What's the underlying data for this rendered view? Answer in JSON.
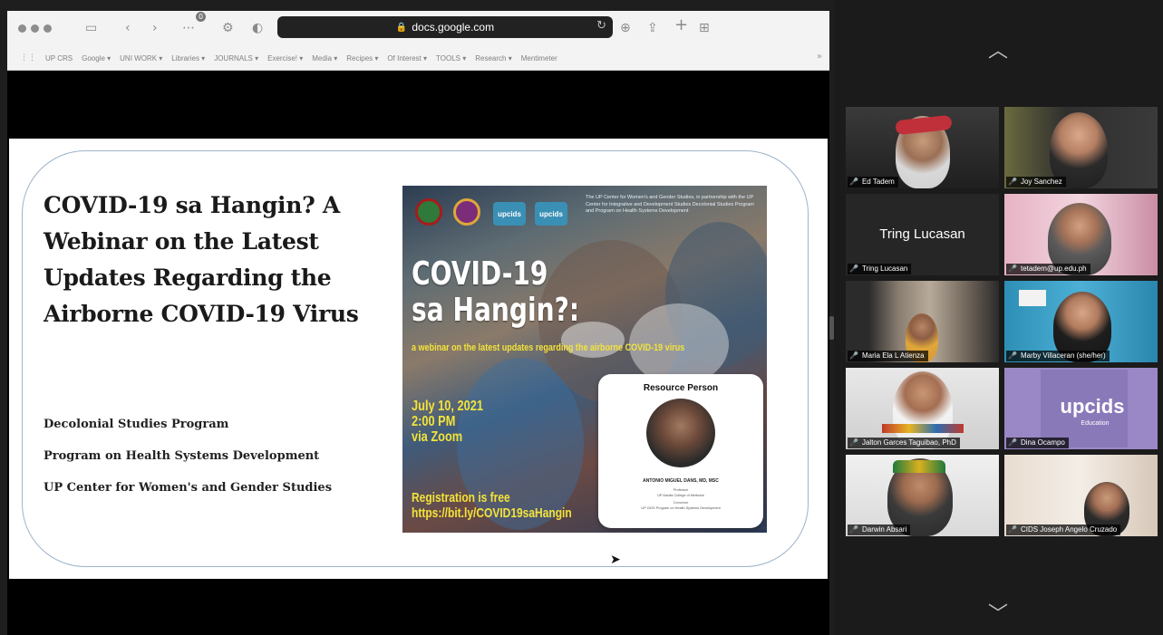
{
  "browser": {
    "url": "docs.google.com",
    "bookmarks": [
      "UP CRS",
      "Google ▾",
      "UNI WORK ▾",
      "Libraries ▾",
      "JOURNALS ▾",
      "Exercise! ▾",
      "Media ▾",
      "Recipes ▾",
      "Of Interest ▾",
      "TOOLS ▾",
      "Research ▾",
      "Mentimeter"
    ],
    "extension_badge": "0"
  },
  "slide": {
    "title": "COVID-19 sa Hangin? A Webinar on the Latest Updates Regarding the Airborne COVID-19 Virus",
    "programs": [
      "Decolonial Studies Program",
      "Program on Health Systems Development",
      "UP Center for Women's and Gender Studies"
    ]
  },
  "poster": {
    "logo_labels": [
      "upcids",
      "upcids"
    ],
    "org_text": "The UP Center for Women's and Gender Studies, in partnership with the UP Center for Integrative and Development Studies Decolonial Studies Program and Program on Health Systems Development",
    "headline_line1": "COVID-19",
    "headline_line2": "sa Hangin?:",
    "subtitle": "a webinar on the latest updates regarding the airborne COVID-19 virus",
    "date_line1": "July 10, 2021",
    "date_line2": "2:00 PM",
    "date_line3": "via Zoom",
    "reg_line1": "Registration is free",
    "reg_line2": "https://bit.ly/COVID19saHangin",
    "resource_title": "Resource Person",
    "resource_name": "ANTONIO MIGUEL DANS, MD, MSC",
    "resource_role1": "Professor",
    "resource_role2": "UP Manila College of Medicine",
    "resource_role3": "Convenor",
    "resource_role4": "UP CIDS Program on Health Systems Development"
  },
  "participants": [
    {
      "name": "Ed Tadem",
      "video": true
    },
    {
      "name": "Joy Sanchez",
      "video": true
    },
    {
      "name": "Tring Lucasan",
      "video": false,
      "display": "Tring Lucasan"
    },
    {
      "name": "tetadem@up.edu.ph",
      "video": true
    },
    {
      "name": "Maria Ela L Atienza",
      "video": true
    },
    {
      "name": "Marby Villaceran (she/her)",
      "video": true,
      "active": true
    },
    {
      "name": "Jalton Garces Taguibao, PhD",
      "video": true
    },
    {
      "name": "Dina Ocampo",
      "video": true,
      "background_text": "upcids",
      "background_sub": "Education"
    },
    {
      "name": "Darwin Absari",
      "video": true
    },
    {
      "name": "CIDS Joseph Angelo Cruzado",
      "video": true
    }
  ],
  "colors": {
    "active_speaker": "#c7d95a",
    "muted_mic": "#e2342e",
    "poster_yellow": "#f3e33a"
  }
}
